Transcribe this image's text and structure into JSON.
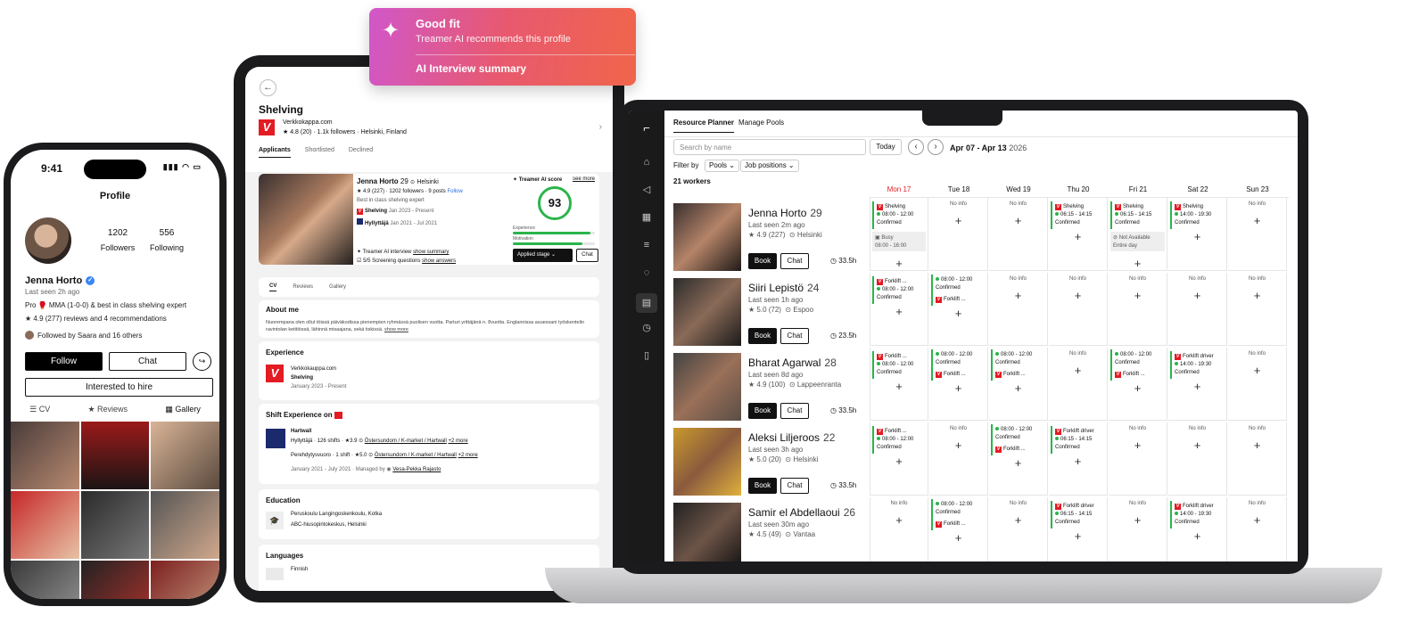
{
  "popup": {
    "title": "Good fit",
    "subtitle": "Treamer AI recommends this profile",
    "link": "AI Interview summary"
  },
  "phone": {
    "time": "9:41",
    "header": "Profile",
    "followers_count": "1202",
    "followers_label": "Followers",
    "following_count": "556",
    "following_label": "Following",
    "name": "Jenna Horto",
    "last_seen": "Last seen 2h ago",
    "bio": "Pro 🥊 MMA (1-0-0) & best in class shelving expert",
    "reviews": "★ 4.9 (277) reviews and 4 recommendations",
    "followed_by": "Followed by Saara and 16 others",
    "follow_btn": "Follow",
    "chat_btn": "Chat",
    "hire_btn": "Interested to hire",
    "tabs": [
      "CV",
      "Reviews",
      "Gallery"
    ]
  },
  "tablet": {
    "job_title": "Shelving",
    "company": "Verkkokappa.com",
    "company_meta": "★ 4.8 (20) · 1.1k followers · Helsinki, Finland",
    "tabs": [
      "Applicants",
      "Shortlisted",
      "Declined"
    ],
    "applicant": {
      "name": "Jenna Horto",
      "age": "29",
      "city": "Helsinki",
      "meta": "★ 4.9 (227) · 1202 followers · 9 posts",
      "follow": "Follow",
      "tagline": "Best in class shelving expert",
      "job1": "Shelving",
      "job1_dates": "Jan 2023 - Present",
      "job2": "Hyllyttäjä",
      "job2_dates": "Jan 2021 - Jul 2021",
      "ai_score_label": "Treamer AI score",
      "see_more": "see more",
      "score": "93",
      "experience_label": "Experience",
      "motivation_label": "Motivation",
      "experience_level": 0.95,
      "motivation_level": 0.85,
      "ai_interview": "Treamer AI interview",
      "show_summary": "show summary",
      "screening": "5/5 Screening questions",
      "show_answers": "show answers",
      "stage_btn": "Applied stage",
      "chat_btn": "Chat"
    },
    "cv_tabs": [
      "CV",
      "Reviews",
      "Gallery"
    ],
    "about_title": "About me",
    "about_text": "Nuorempana olen ollut töissä päiväkodissa pienempien ryhmässä puolisen vuotta. Parturi yrittäjänä n. 8vuotta. Englannissa asuessani työskentelin ravintolan keittiössä, lähinnä misaajana, sekä tiskissä.",
    "about_more": "show more",
    "experience_title": "Experience",
    "exp_company": "Verkkokauppa.com",
    "exp_role": "Shelving",
    "exp_dates": "January 2023 - Present",
    "shift_title": "Shift Experience on",
    "shift_company": "Hartwall",
    "shift1": "Hyllyttäjä",
    "shift1_meta": "126 shifts · ★3.9",
    "shift1_loc": "Östersundom / K-market / Hartwall",
    "shift1_more": "+2 more",
    "shift2": "Perehdytysvuoro",
    "shift2_meta": "1 shift · ★5.0",
    "shift2_loc": "Östersundom / K-market / Hartwall",
    "shift2_more": "+2 more",
    "shift_dates": "January 2021 - July 2021 · Managed by",
    "shift_manager": "Vesa-Pekka Rajasto",
    "education_title": "Education",
    "edu1": "Peruskoulu Langingoskenkoulu, Kotka",
    "edu2": "ABC-hiusopintokeskus, Helsinki",
    "languages_title": "Languages",
    "lang1": "Finnish"
  },
  "laptop": {
    "tabs": [
      "Resource Planner",
      "Manage Pools"
    ],
    "search_placeholder": "Search by name",
    "today_btn": "Today",
    "date_range": "Apr 07 - Apr 13",
    "year": "2026",
    "filter_label": "Filter by",
    "filter_pools": "Pools",
    "filter_jobs": "Job positions",
    "workers_count": "21 workers",
    "days": [
      "Mon 17",
      "Tue 18",
      "Wed 19",
      "Thu 20",
      "Fri 21",
      "Sat 22",
      "Sun 23"
    ],
    "today_color": "#e31b23",
    "book_btn": "Book",
    "chat_btn": "Chat",
    "no_info": "No info",
    "workers": [
      {
        "name": "Jenna Horto",
        "age": "29",
        "seen": "Last seen 2m ago",
        "rating": "★ 4.9 (227)",
        "city": "Helsinki",
        "hours": "33.5h"
      },
      {
        "name": "Siiri Lepistö",
        "age": "24",
        "seen": "Last seen 1h ago",
        "rating": "★ 5.0 (72)",
        "city": "Espoo",
        "hours": "23.5h"
      },
      {
        "name": "Bharat Agarwal",
        "age": "28",
        "seen": "Last seen 8d ago",
        "rating": "★ 4.9 (100)",
        "city": "Lappeenranta",
        "hours": "33.5h"
      },
      {
        "name": "Aleksi Liljeroos",
        "age": "22",
        "seen": "Last seen 3h ago",
        "rating": "★ 5.0 (20)",
        "city": "Helsinki",
        "hours": "33.5h"
      },
      {
        "name": "Samir el Abdellaoui",
        "age": "26",
        "seen": "Last seen 30m ago",
        "rating": "★ 4.5 (49)",
        "city": "Vantaa",
        "hours": ""
      }
    ],
    "shift_labels": {
      "shelving": "Shelving",
      "forklift": "Forklift ...",
      "forklift_driver": "Forklift driver",
      "confirmed": "Confirmed",
      "t1": "08:00 - 12:00",
      "t2": "06:15 - 14:15",
      "t3": "14:00 - 19:30",
      "busy": "Busy",
      "busy_time": "08:00 - 16:00",
      "not_available": "Not Available",
      "entire_day": "Entire day"
    }
  }
}
